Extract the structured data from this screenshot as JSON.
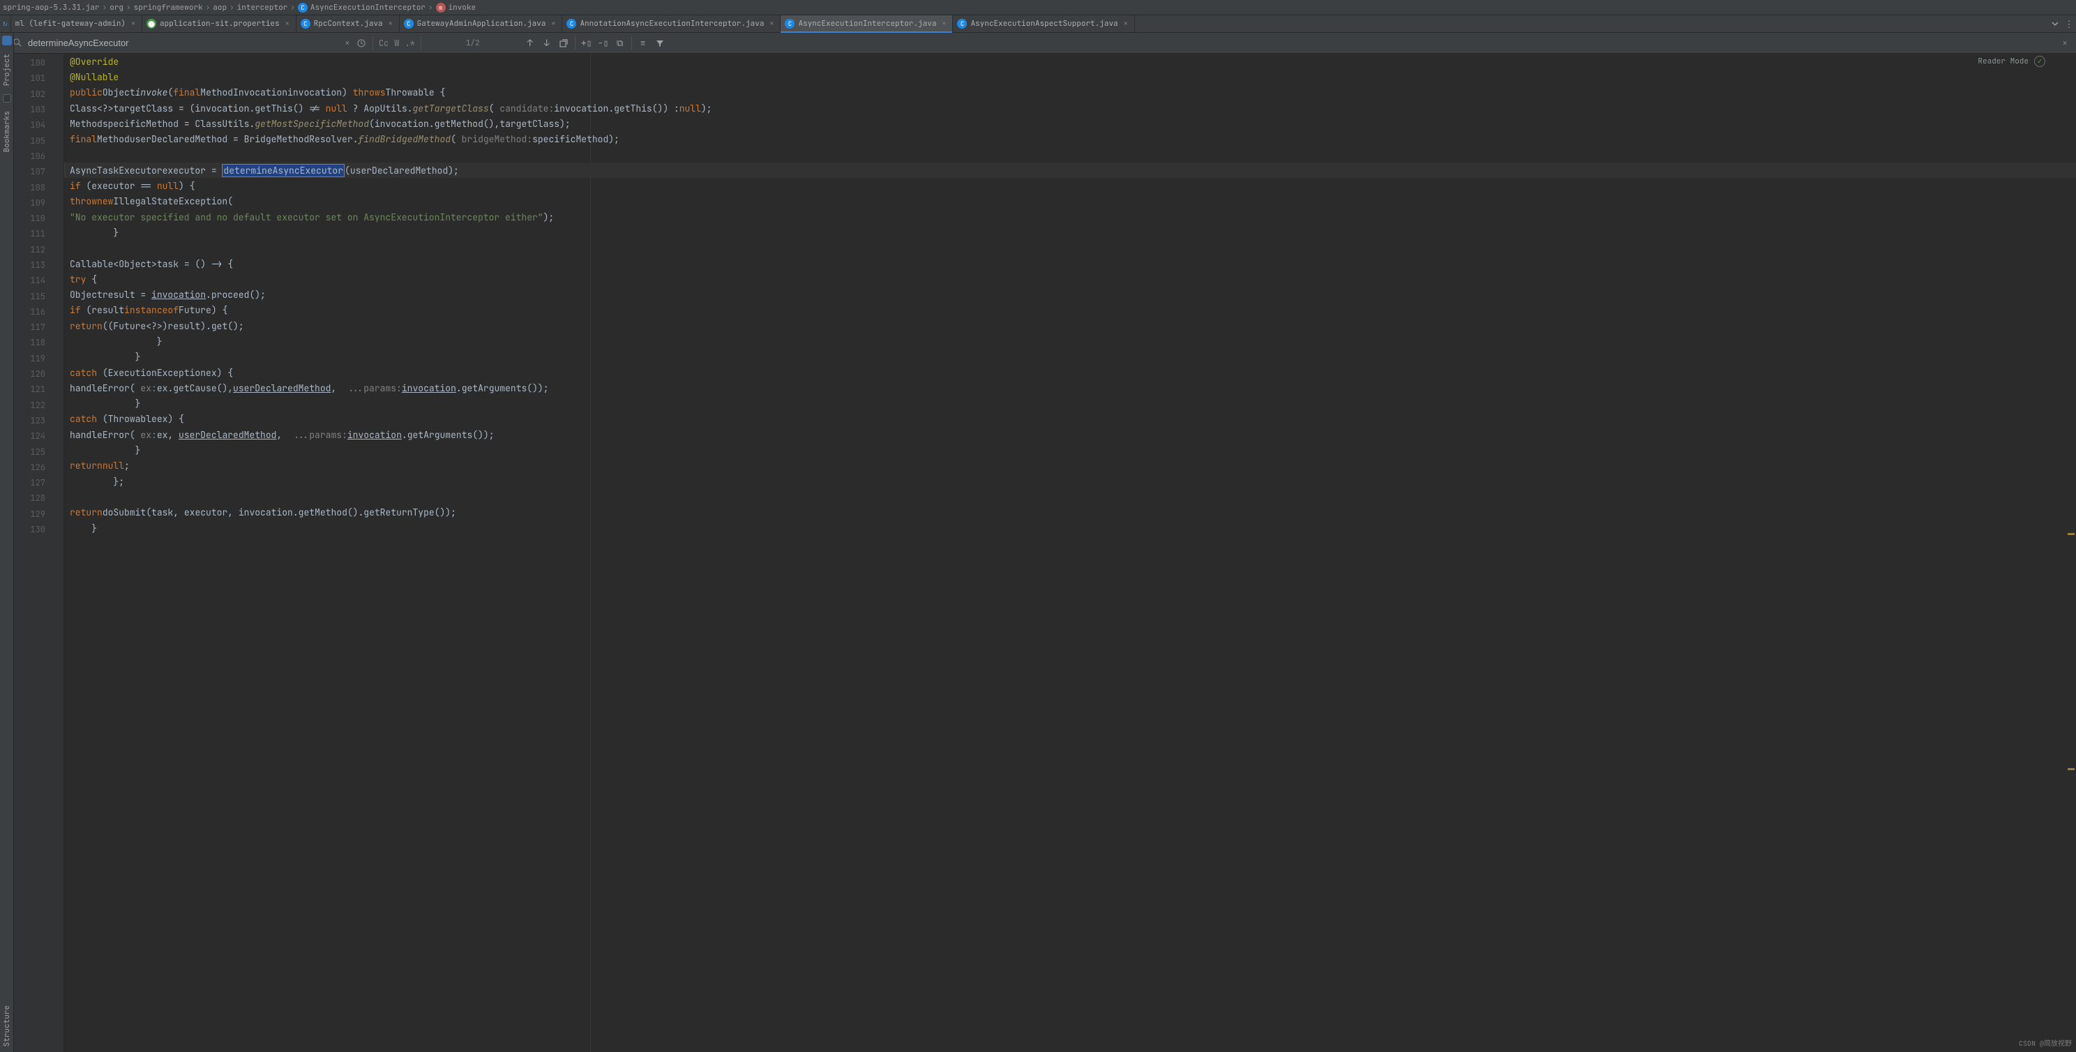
{
  "breadcrumb": {
    "items": [
      {
        "name": "spring-aop-5.3.31.jar"
      },
      {
        "name": "org"
      },
      {
        "name": "springframework"
      },
      {
        "name": "aop"
      },
      {
        "name": "interceptor"
      },
      {
        "name": "AsyncExecutionInterceptor",
        "icon": "c"
      },
      {
        "name": "invoke",
        "icon": "m"
      }
    ]
  },
  "tabs": {
    "items": [
      {
        "label": "ml (lefit-gateway-admin)",
        "icon": "none"
      },
      {
        "label": "application-sit.properties",
        "icon": "props"
      },
      {
        "label": "RpcContext.java",
        "icon": "java"
      },
      {
        "label": "GatewayAdminApplication.java",
        "icon": "java"
      },
      {
        "label": "AnnotationAsyncExecutionInterceptor.java",
        "icon": "java"
      },
      {
        "label": "AsyncExecutionInterceptor.java",
        "icon": "java",
        "active": true
      },
      {
        "label": "AsyncExecutionAspectSupport.java",
        "icon": "java"
      }
    ]
  },
  "search": {
    "query": "determineAsyncExecutor",
    "toggles": {
      "cc": "Cc",
      "w": "W",
      "regex": ".*"
    },
    "count": "1/2"
  },
  "reader_mode": "Reader Mode",
  "lines": {
    "start": 100,
    "end": 130,
    "caret_line": 107,
    "t100": "@Override",
    "t101": "@Nullable",
    "t102_a": "public",
    "t102_b": "Object",
    "t102_c": "invoke",
    "t102_d": "final",
    "t102_e": "MethodInvocation",
    "t102_f": "invocation",
    "t102_g": "throws",
    "t102_h": "Throwable",
    "t103_a": "Class<?>",
    "t103_b": "targetClass",
    "t103_c": "invocation",
    "t103_d": ".getThis()",
    "t103_e": "null",
    "t103_f": "AopUtils.",
    "t103_g": "getTargetClass",
    "t103_h": "candidate:",
    "t103_i": "invocation",
    "t103_j": ".getThis()) :",
    "t103_k": "null",
    "t104_a": "Method",
    "t104_b": "specificMethod",
    "t104_c": "ClassUtils.",
    "t104_d": "getMostSpecificMethod",
    "t104_e": "invocation",
    "t104_f": ".getMethod(),",
    "t104_g": "targetClass",
    "t105_a": "final",
    "t105_b": "Method",
    "t105_c": "userDeclaredMethod",
    "t105_d": "BridgeMethodResolver.",
    "t105_e": "findBridgedMethod",
    "t105_f": "bridgeMethod:",
    "t105_g": "specificMethod",
    "t107_a": "AsyncTaskExecutor",
    "t107_b": "executor",
    "t107_c": "determineAsyncExecutor",
    "t107_d": "userDeclaredMethod",
    "t108_a": "if",
    "t108_b": "executor",
    "t108_c": "null",
    "t109_a": "throw",
    "t109_b": "new",
    "t109_c": "IllegalStateException",
    "t110": "\"No executor specified and no default executor set on AsyncExecutionInterceptor either\"",
    "t113_a": "Callable<Object>",
    "t113_b": "task",
    "t114": "try",
    "t115_a": "Object",
    "t115_b": "result",
    "t115_c": "invocation",
    "t115_d": ".proceed();",
    "t116_a": "if",
    "t116_b": "result",
    "t116_c": "instanceof",
    "t116_d": "Future",
    "t117_a": "return",
    "t117_b": "((Future<?>)",
    "t117_c": "result",
    "t120_a": "catch",
    "t120_b": "ExecutionException",
    "t120_c": "ex",
    "t121_a": "handleError",
    "t121_b": "ex:",
    "t121_c": "ex",
    "t121_d": ".getCause(),",
    "t121_e": "userDeclaredMethod",
    "t121_f": "...params:",
    "t121_g": "invocation",
    "t121_h": ".getArguments());",
    "t123_a": "catch",
    "t123_b": "Throwable",
    "t123_c": "ex",
    "t124_a": "handleError",
    "t124_b": "ex:",
    "t124_c": "ex",
    "t124_d": "userDeclaredMethod",
    "t124_e": "...params:",
    "t124_f": "invocation",
    "t124_g": ".getArguments());",
    "t126_a": "return",
    "t126_b": "null",
    "t129_a": "return",
    "t129_b": "doSubmit",
    "t129_c": "task",
    "t129_d": "executor",
    "t129_e": "invocation",
    "t129_f": ".getMethod().getReturnType());"
  },
  "side": {
    "project": "Project",
    "bookmarks": "Bookmarks",
    "structure": "Structure"
  },
  "watermark": "CSDN @简放视野"
}
